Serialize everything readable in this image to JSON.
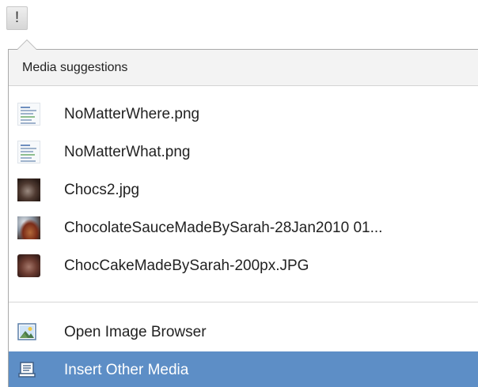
{
  "trigger": {
    "label": "!",
    "icon": "exclamation-icon"
  },
  "panel": {
    "header": "Media suggestions",
    "media_items": [
      {
        "label": "NoMatterWhere.png",
        "thumb": "document-thumbnail"
      },
      {
        "label": "NoMatterWhat.png",
        "thumb": "document-thumbnail"
      },
      {
        "label": "Chocs2.jpg",
        "thumb": "chocolate-thumbnail"
      },
      {
        "label": "ChocolateSauceMadeBySarah-28Jan2010 01...",
        "thumb": "chocolate-sauce-thumbnail"
      },
      {
        "label": "ChocCakeMadeBySarah-200px.JPG",
        "thumb": "chocolate-cake-thumbnail"
      }
    ],
    "actions": [
      {
        "label": "Open Image Browser",
        "icon": "image-browser-icon",
        "selected": false
      },
      {
        "label": "Insert Other Media",
        "icon": "document-icon",
        "selected": true
      }
    ]
  },
  "colors": {
    "selected_bg": "#5d8ec6",
    "header_bg": "#f3f3f3",
    "border": "#a9a9a9"
  }
}
